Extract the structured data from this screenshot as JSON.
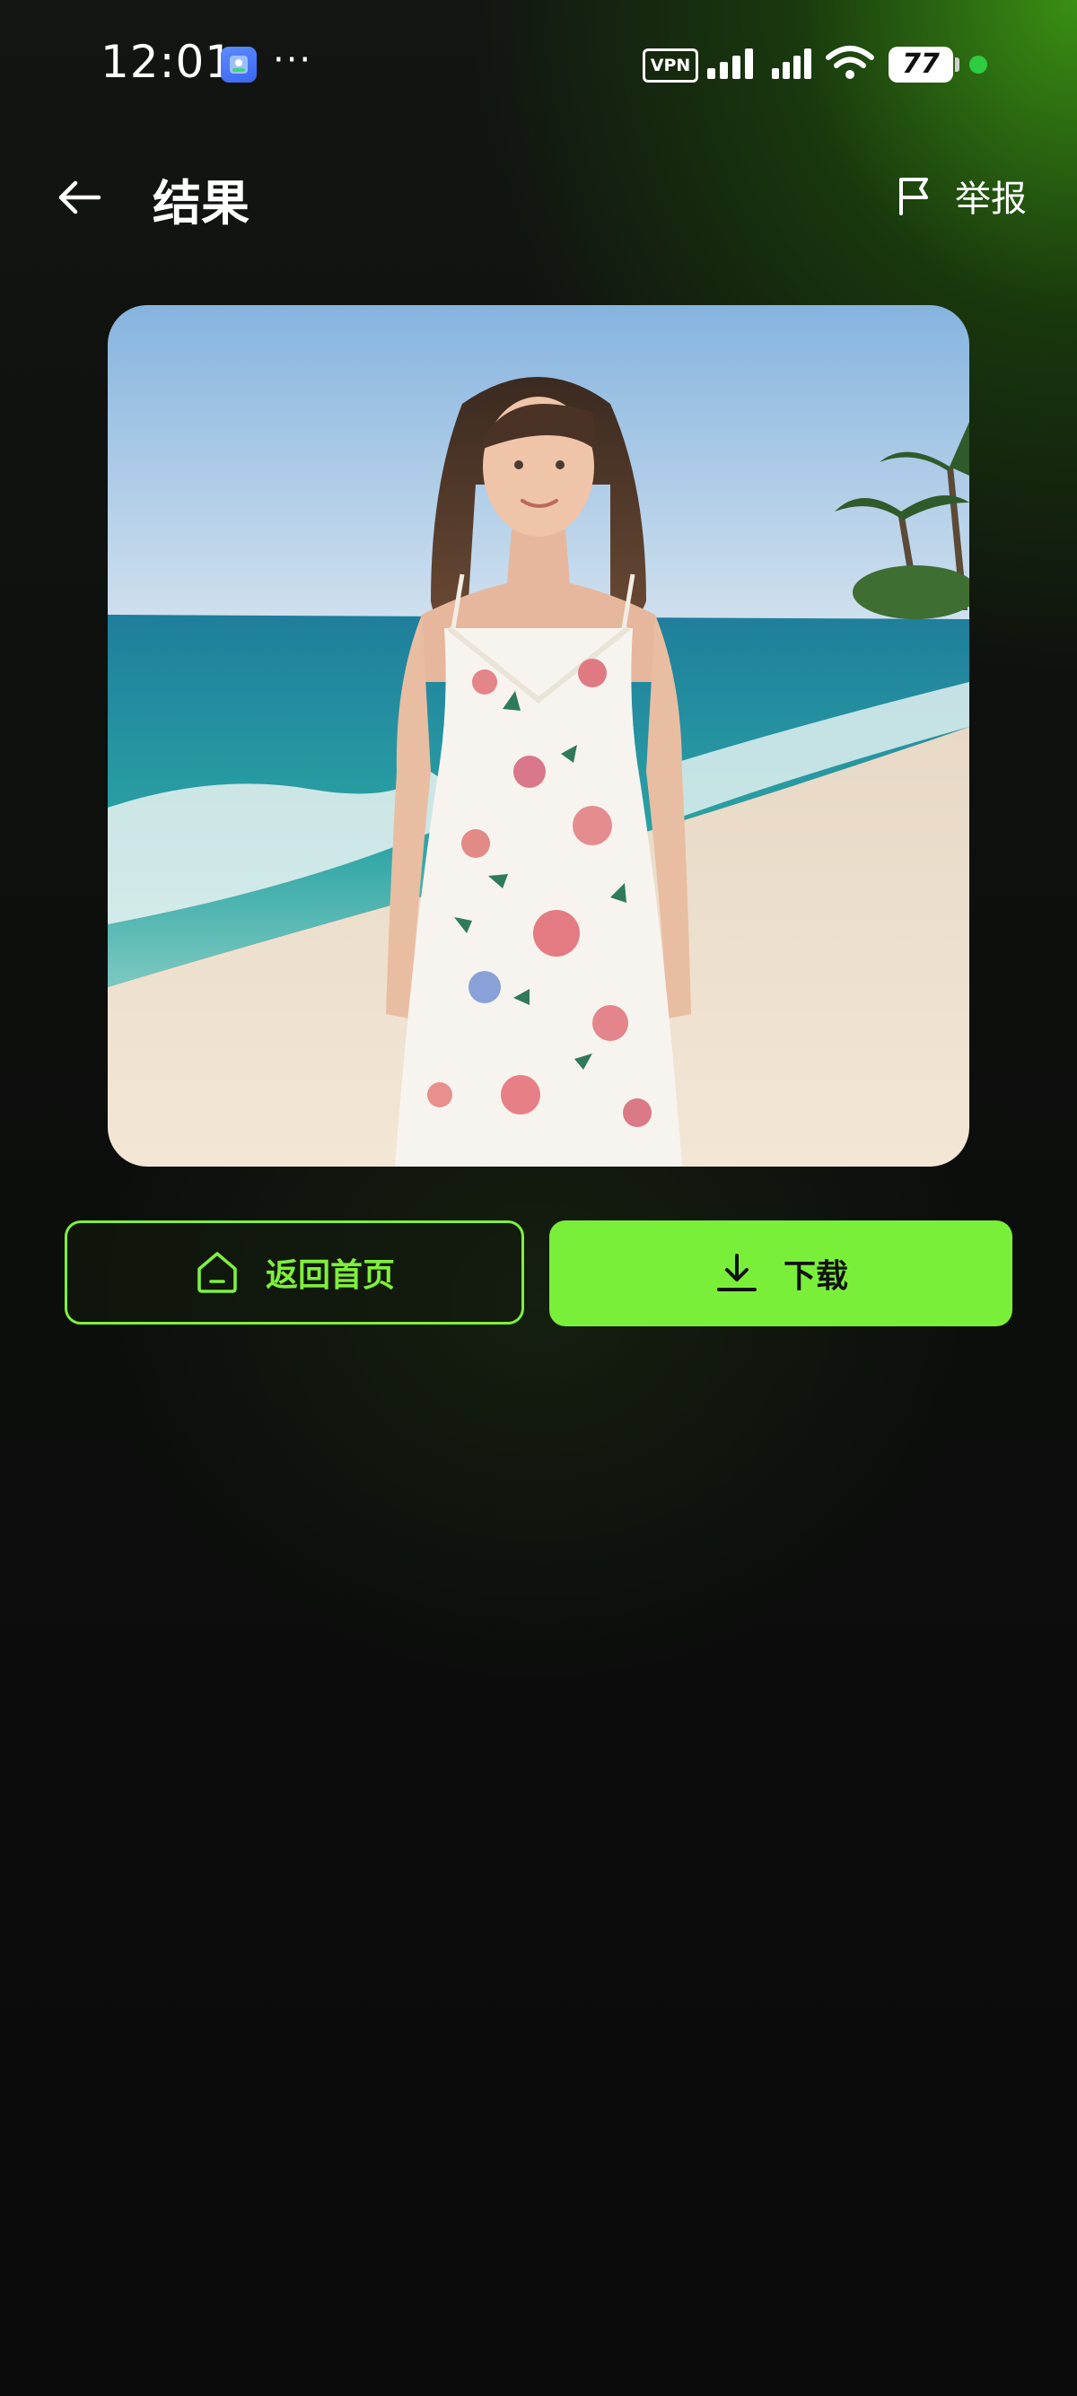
{
  "status_bar": {
    "time": "12:01",
    "more_indicator": "···",
    "vpn_label": "VPN",
    "battery_level": "77",
    "icons": [
      "app-notification-icon",
      "signal-icon",
      "wifi-icon",
      "battery-icon",
      "charging-dot"
    ]
  },
  "header": {
    "title": "结果",
    "back_icon": "arrow-left-icon",
    "report_label": "举报",
    "report_icon": "flag-icon"
  },
  "result": {
    "image_subject": "woman in floral sundress on a tropical beach"
  },
  "actions": {
    "home_label": "返回首页",
    "home_icon": "home-icon",
    "download_label": "下载",
    "download_icon": "download-icon"
  },
  "colors": {
    "accent_green": "#7aef3a",
    "background": "#0b0b0b",
    "text_primary": "#ffffff"
  }
}
